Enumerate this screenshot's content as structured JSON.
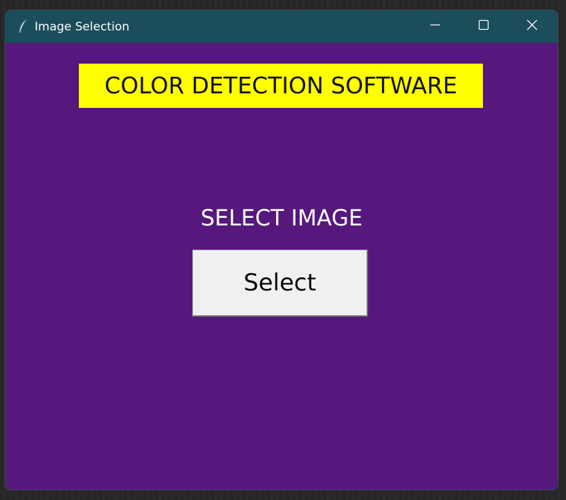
{
  "window": {
    "title": "Image Selection",
    "icon": "feather-icon",
    "controls": {
      "minimize_icon": "minimize-icon",
      "maximize_icon": "maximize-icon",
      "close_icon": "close-icon"
    }
  },
  "content": {
    "heading": "COLOR DETECTION SOFTWARE",
    "select_label": "SELECT IMAGE",
    "select_button": "Select"
  },
  "colors": {
    "titlebar": "#1b4d5b",
    "background": "#56187c",
    "heading_bg": "#ffff00",
    "button_bg": "#f0f0f0"
  }
}
